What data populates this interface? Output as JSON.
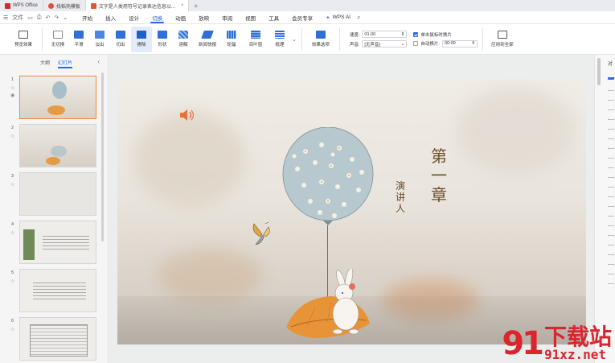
{
  "tabs": [
    {
      "label": "WPS Office"
    },
    {
      "label": "找稻壳模板"
    },
    {
      "label": "文字是人类用符号记录表达信息以..."
    }
  ],
  "menu": {
    "file": "文件",
    "items": [
      "开始",
      "插入",
      "设计",
      "切换",
      "动画",
      "放映",
      "审阅",
      "视图",
      "工具",
      "会员专享"
    ],
    "active": "切换",
    "ai": "WPS AI"
  },
  "ribbon": {
    "preview": "预览效果",
    "effects": [
      "无切换",
      "平滑",
      "淡出",
      "切出",
      "擦除",
      "形状",
      "溶解",
      "新闻快报",
      "轮辐",
      "百叶窗",
      "梳理"
    ],
    "selected_effect": "擦除",
    "effect_options": "效果选项",
    "speed_label": "速度:",
    "speed_value": "01.00",
    "sound_label": "声音:",
    "sound_value": "[无声音]",
    "on_click": "单击鼠标时换片",
    "auto_advance": "自动换片:",
    "auto_time": "00:00",
    "apply_all": "应用到全部"
  },
  "left_panel": {
    "tab_outline": "大纲",
    "tab_slides": "幻灯片",
    "slides": [
      "1",
      "2",
      "3",
      "4",
      "5",
      "6"
    ]
  },
  "slide": {
    "title_chars": [
      "第",
      "一",
      "章"
    ],
    "speaker_chars": [
      "演",
      "讲",
      "人"
    ]
  },
  "right_panel": {
    "label": "对"
  },
  "watermark": {
    "num": "91",
    "cn": "下载站",
    "url": "91xz.net"
  },
  "colors": {
    "accent": "#2b6ae6",
    "slide_text": "#6a4e2e",
    "selection": "#f08a3c",
    "watermark": "#d9262e"
  }
}
